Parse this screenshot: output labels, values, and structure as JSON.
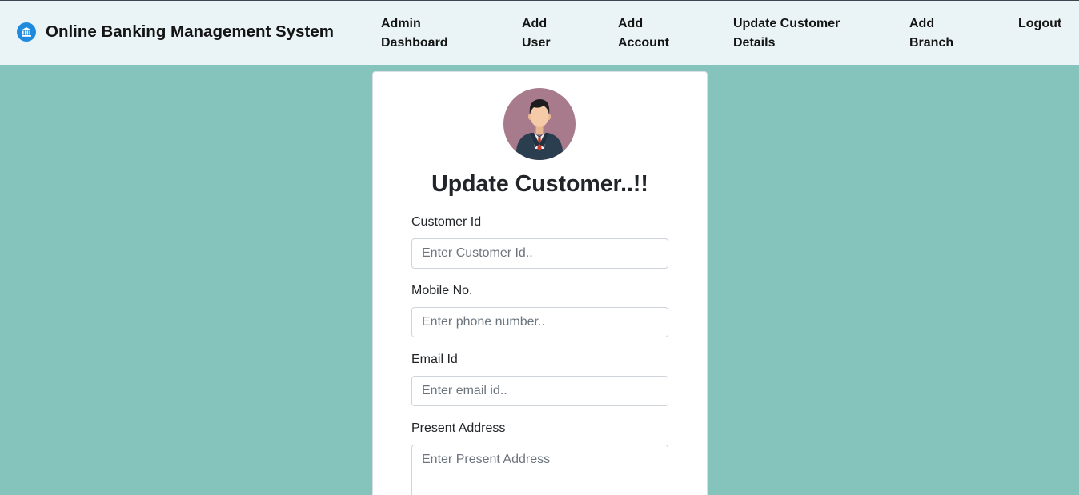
{
  "navbar": {
    "brand_icon": "bank-icon",
    "brand_title": "Online Banking Management System",
    "items": [
      {
        "line1": "Admin",
        "line2": "Dashboard"
      },
      {
        "line1": "Add",
        "line2": "User"
      },
      {
        "line1": "Add",
        "line2": "Account"
      },
      {
        "line1": "Update Customer",
        "line2": "Details"
      },
      {
        "line1": "Add",
        "line2": "Branch"
      },
      {
        "line1": "Logout",
        "line2": ""
      }
    ]
  },
  "form": {
    "avatar_icon": "customer-avatar-icon",
    "title": "Update Customer..!!",
    "customer_id": {
      "label": "Customer Id",
      "placeholder": "Enter Customer Id..",
      "value": ""
    },
    "mobile": {
      "label": "Mobile No.",
      "placeholder": "Enter phone number..",
      "value": ""
    },
    "email": {
      "label": "Email Id",
      "placeholder": "Enter email id..",
      "value": ""
    },
    "address": {
      "label": "Present Address",
      "placeholder": "Enter Present Address",
      "value": ""
    }
  },
  "colors": {
    "page_background": "#85c3bd",
    "navbar_background": "#eaf4f7",
    "brand_icon": "#1d8ae0",
    "avatar_background": "#a77a8c"
  }
}
